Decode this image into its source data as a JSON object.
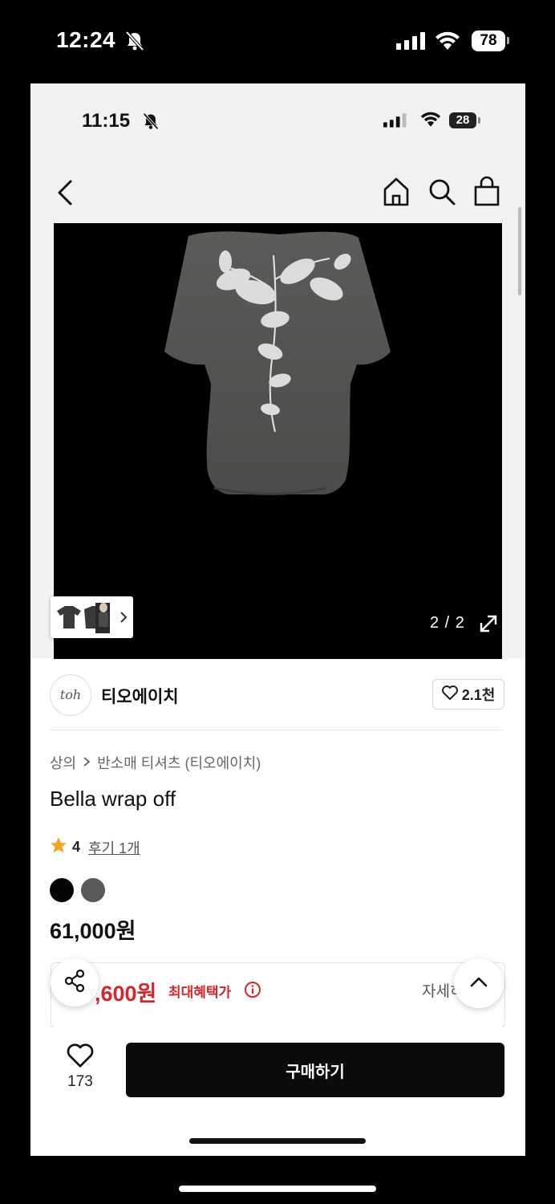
{
  "outer_status": {
    "time": "12:24",
    "battery": "78",
    "bell_icon": "bell-slash-icon"
  },
  "inner_status": {
    "time": "11:15",
    "battery": "28"
  },
  "nav": {
    "icons": [
      "chevron-left-icon",
      "home-icon",
      "search-icon",
      "shopping-bag-icon"
    ]
  },
  "product": {
    "image_counter": "2 / 2",
    "shop_name": "티오에이치",
    "shop_logo": "toh",
    "shop_likes": "2.1천",
    "breadcrumb": [
      "상의",
      "반소매 티셔츠 (티오에이치)"
    ],
    "title": "Bella wrap off",
    "rating": "4",
    "reviews": "후기 1개",
    "colors": [
      "#050505",
      "#5a5a5a"
    ],
    "price": "61,000원"
  },
  "benefit": {
    "price": ",600원",
    "label": "최대혜택가",
    "detail": "자세히"
  },
  "bottom": {
    "wish_count": "173",
    "buy_label": "구매하기"
  },
  "accent": {
    "benefit_red": "#d8242b",
    "buy_button": "#0b0b0b"
  }
}
